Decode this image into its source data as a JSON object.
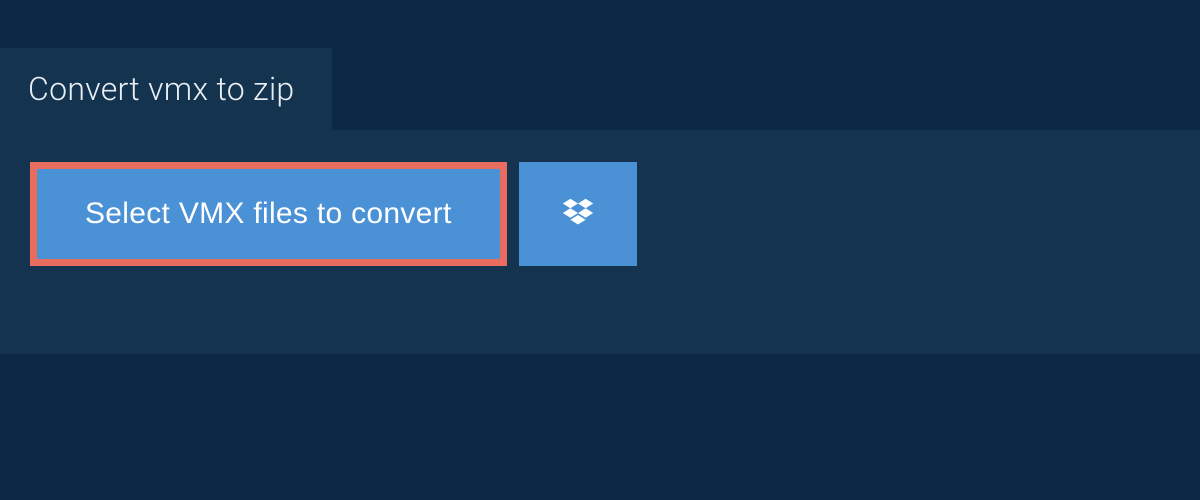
{
  "header": {
    "title": "Convert vmx to zip"
  },
  "actions": {
    "select_label": "Select VMX files to convert",
    "dropbox_icon": "dropbox-icon"
  },
  "colors": {
    "bg_dark": "#0d2844",
    "panel": "#13334f",
    "button": "#4a91d6",
    "highlight": "#e86d5e",
    "text_light": "#e8eef4"
  }
}
